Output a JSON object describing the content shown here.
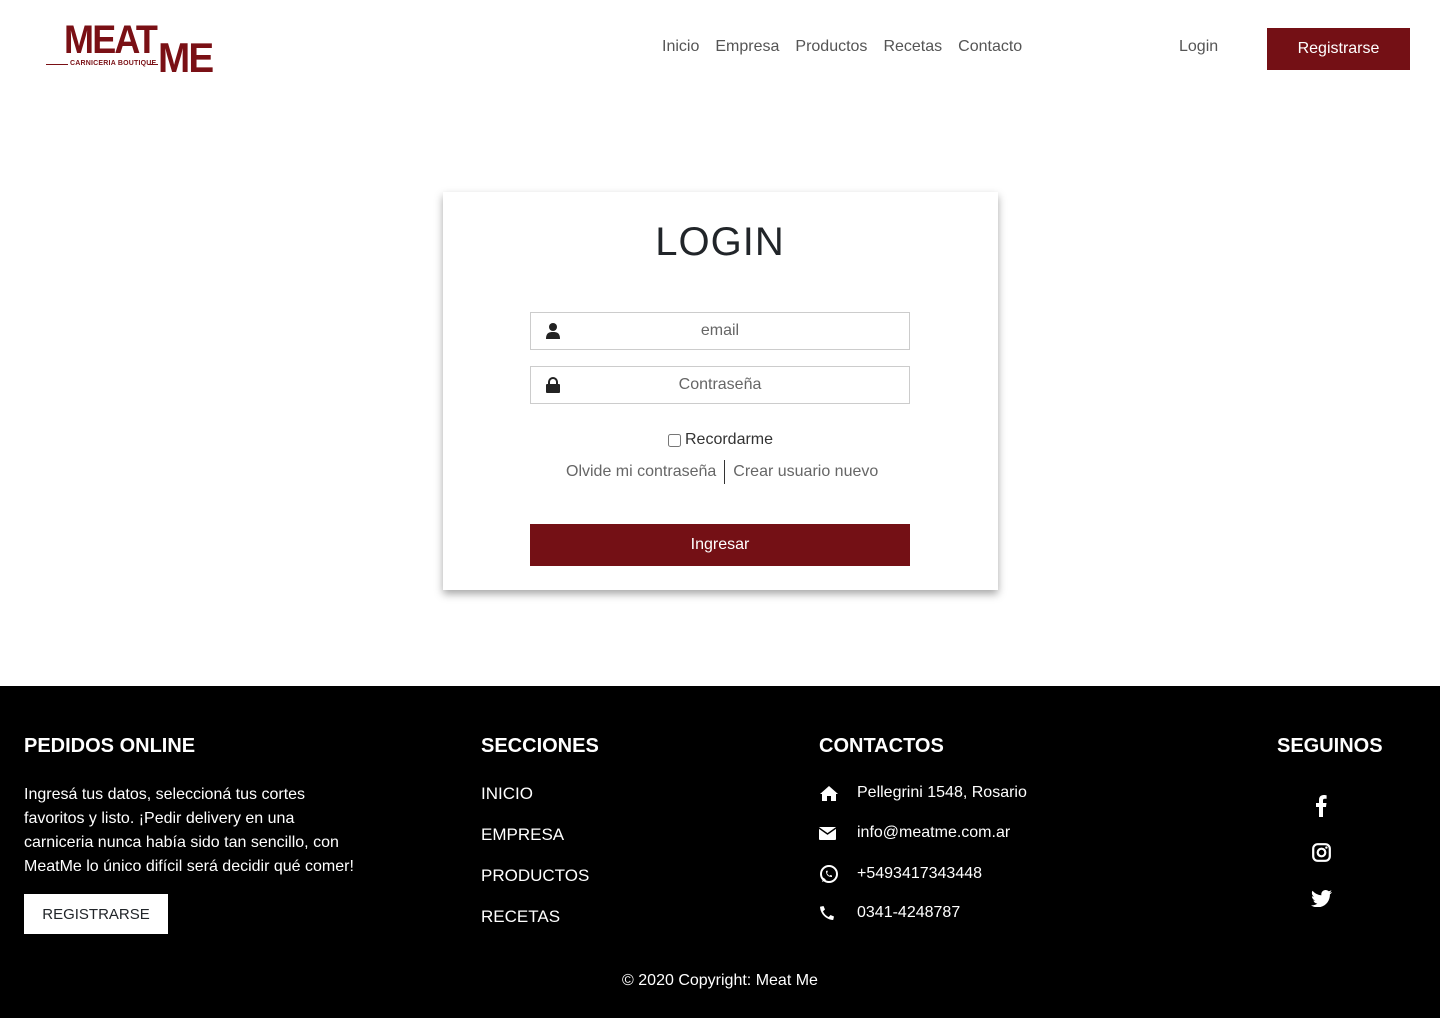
{
  "brand": {
    "logo_top": "MEAT",
    "logo_bottom": "ME",
    "logo_tagline": "CARNICERIA BOUTIQUE",
    "accent_color": "#741015"
  },
  "nav": {
    "items": [
      {
        "label": "Inicio"
      },
      {
        "label": "Empresa"
      },
      {
        "label": "Productos"
      },
      {
        "label": "Recetas"
      },
      {
        "label": "Contacto"
      }
    ],
    "login_label": "Login",
    "register_label": "Registrarse"
  },
  "login": {
    "title": "LOGIN",
    "email_placeholder": "email",
    "email_icon": "user-icon",
    "password_placeholder": "Contraseña",
    "password_icon": "lock-icon",
    "remember_label": "Recordarme",
    "remember_checked": false,
    "forgot_label": "Olvide mi contraseña",
    "create_label": "Crear usuario nuevo",
    "submit_label": "Ingresar"
  },
  "footer": {
    "pedidos": {
      "heading": "PEDIDOS ONLINE",
      "text": "Ingresá tus datos, seleccioná tus cortes favoritos y listo. ¡Pedir delivery en una carniceria nunca había sido tan sencillo, con MeatMe lo único difícil será decidir qué comer!",
      "button_label": "REGISTRARSE"
    },
    "secciones": {
      "heading": "SECCIONES",
      "items": [
        "INICIO",
        "EMPRESA",
        "PRODUCTOS",
        "RECETAS"
      ]
    },
    "contactos": {
      "heading": "CONTACTOS",
      "items": [
        {
          "icon": "home-icon",
          "text": "Pellegrini 1548, Rosario"
        },
        {
          "icon": "envelope-icon",
          "text": "info@meatme.com.ar"
        },
        {
          "icon": "whatsapp-icon",
          "text": "+5493417343448"
        },
        {
          "icon": "phone-icon",
          "text": "0341-4248787"
        }
      ]
    },
    "seguinos": {
      "heading": "SEGUINOS",
      "items": [
        "facebook-icon",
        "instagram-icon",
        "twitter-icon"
      ]
    },
    "copyright": "© 2020 Copyright: Meat Me"
  }
}
